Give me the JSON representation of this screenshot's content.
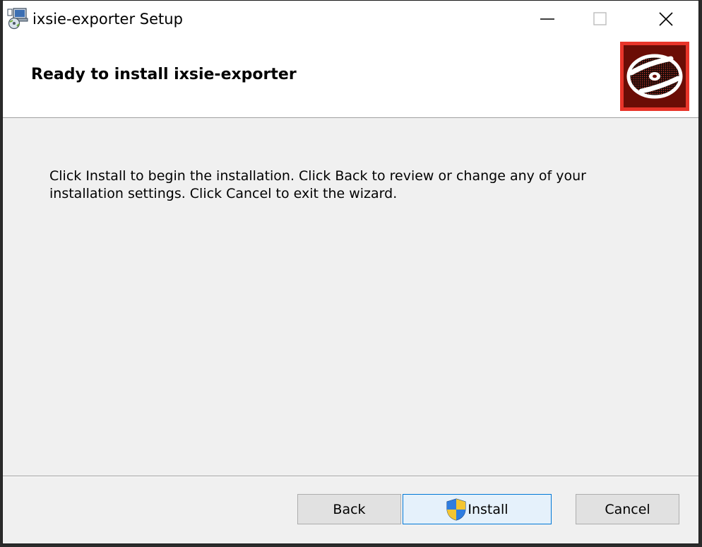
{
  "window": {
    "title": "ixsie-exporter Setup"
  },
  "banner": {
    "title": "Ready to install ixsie-exporter",
    "logo_icon": "disc-icon",
    "logo_colors": {
      "border": "#e8352a",
      "background": "#6b0d06"
    }
  },
  "content": {
    "description": "Click Install to begin the installation. Click Back to review or change any of your installation settings. Click Cancel to exit the wizard."
  },
  "buttons": {
    "back": "Back",
    "install": "Install",
    "cancel": "Cancel"
  },
  "colors": {
    "accent": "#0078d7",
    "install_bg": "#e5f1fb"
  }
}
